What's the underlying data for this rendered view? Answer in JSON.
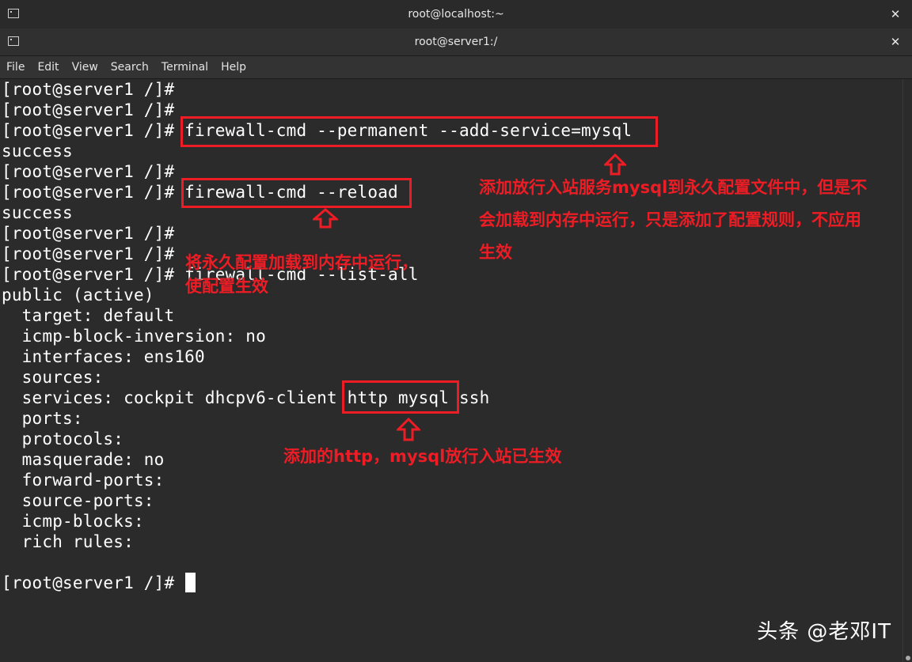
{
  "outer_window": {
    "title": "root@localhost:~"
  },
  "inner_window": {
    "title": "root@server1:/"
  },
  "menu": [
    "File",
    "Edit",
    "View",
    "Search",
    "Terminal",
    "Help"
  ],
  "terminal_lines": [
    "[root@server1 /]#",
    "[root@server1 /]#",
    "[root@server1 /]# firewall-cmd --permanent --add-service=mysql",
    "success",
    "[root@server1 /]#",
    "[root@server1 /]# firewall-cmd --reload",
    "success",
    "[root@server1 /]#",
    "[root@server1 /]#",
    "[root@server1 /]# firewall-cmd --list-all",
    "public (active)",
    "  target: default",
    "  icmp-block-inversion: no",
    "  interfaces: ens160",
    "  sources:",
    "  services: cockpit dhcpv6-client http mysql ssh",
    "  ports:",
    "  protocols:",
    "  masquerade: no",
    "  forward-ports:",
    "  source-ports:",
    "  icmp-blocks:",
    "  rich rules:",
    "",
    "[root@server1 /]# "
  ],
  "annotations": {
    "permanent_note": [
      "添加放行入站服务mysql到永久配置文件中，但是不",
      "会加载到内存中运行，只是添加了配置规则，不应用",
      "生效"
    ],
    "reload_note": [
      "将永久配置加载到内存中运行，",
      "使配置生效"
    ],
    "services_note": "添加的http，mysql放行入站已生效"
  },
  "colors": {
    "accent": "#ee1c25",
    "background": "#2b2b2b",
    "text": "#ffffff"
  },
  "watermark": "头条 @老邓IT"
}
